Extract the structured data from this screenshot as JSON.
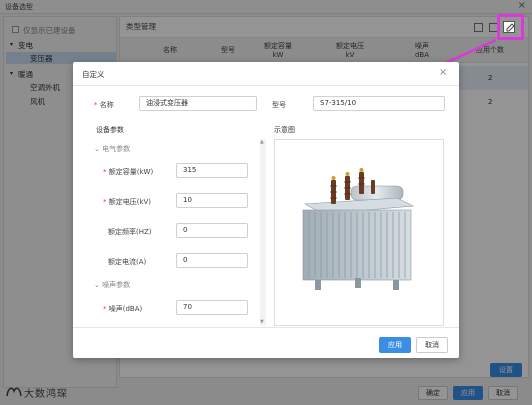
{
  "window": {
    "title": "设备选型",
    "close": "×"
  },
  "left_panel": {
    "only_built": "仅显示已建设备",
    "tree": [
      {
        "label": "变电",
        "expanded": true,
        "children": [
          {
            "label": "变压器",
            "selected": true
          }
        ]
      },
      {
        "label": "暖通",
        "expanded": true,
        "children": [
          {
            "label": "空调外机"
          },
          {
            "label": "风机"
          }
        ]
      }
    ]
  },
  "right_panel": {
    "title": "类型管理",
    "table": {
      "columns": [
        "名称",
        "型号",
        "额定容量\nkW",
        "额定电压\nkV",
        "噪声\ndBA",
        "应用个数"
      ],
      "rows": [
        [
          "2"
        ],
        [
          "2"
        ]
      ]
    },
    "settings_button": "设置"
  },
  "footer": {
    "logo_text": "大数鸿琛",
    "confirm": "确定",
    "apply": "应用",
    "cancel": "取消"
  },
  "dialog": {
    "title": "自定义",
    "close": "×",
    "name_label": "名称",
    "name_value": "油浸式变压器",
    "model_label": "型号",
    "model_value": "S7-315/10",
    "params_title": "设备参数",
    "schematic_title": "示意图",
    "electrical_section": "电气参数",
    "fields": [
      {
        "label": "额定容量(kW)",
        "required": true,
        "value": "315"
      },
      {
        "label": "额定电压(kV)",
        "required": true,
        "value": "10"
      },
      {
        "label": "额定频率(HZ)",
        "required": false,
        "value": "0"
      },
      {
        "label": "额定电流(A)",
        "required": false,
        "value": "0"
      }
    ],
    "noise_section": "噪声参数",
    "noise_field": {
      "label": "噪声(dBA)",
      "required": true,
      "value": "70"
    },
    "apply": "应用",
    "cancel": "取消"
  },
  "colors": {
    "accent": "#3a8ee6",
    "highlight": "#d93ad9",
    "required": "#e53935"
  }
}
